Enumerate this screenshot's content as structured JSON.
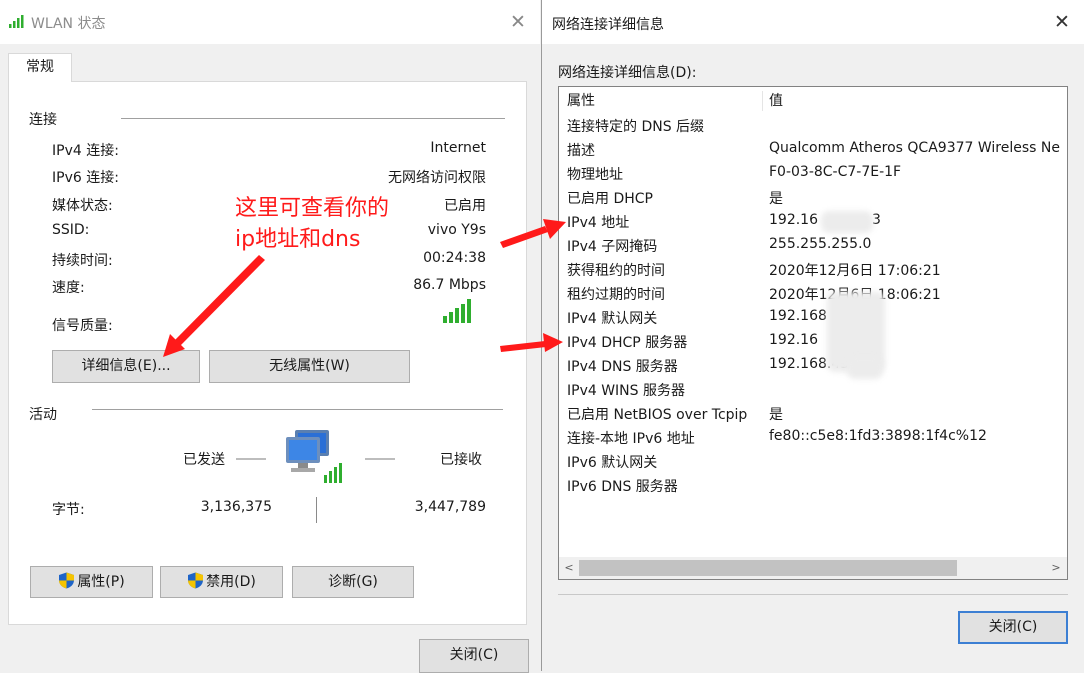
{
  "wlan_window": {
    "title": "WLAN 状态",
    "close_glyph": "✕",
    "tab": "常规",
    "connection": {
      "heading": "连接",
      "rows": [
        {
          "label": "IPv4 连接:",
          "value": "Internet"
        },
        {
          "label": "IPv6 连接:",
          "value": "无网络访问权限"
        },
        {
          "label": "媒体状态:",
          "value": "已启用"
        },
        {
          "label": "SSID:",
          "value": "vivo Y9s"
        },
        {
          "label": "持续时间:",
          "value": "00:24:38"
        },
        {
          "label": "速度:",
          "value": "86.7 Mbps"
        }
      ],
      "signal_label": "信号质量:",
      "signal_bars": 5
    },
    "buttons": {
      "details": "详细信息(E)...",
      "wireless_props": "无线属性(W)"
    },
    "activity": {
      "heading": "活动",
      "sent_label": "已发送",
      "received_label": "已接收",
      "bytes_label": "字节:",
      "bytes_sent": "3,136,375",
      "bytes_received": "3,447,789"
    },
    "bottom_buttons": {
      "properties": "属性(P)",
      "disable": "禁用(D)",
      "diagnose": "诊断(G)"
    },
    "close_button": "关闭(C)"
  },
  "annotation": {
    "line1": "这里可查看你的",
    "line2": "ip地址和dns",
    "color": "#ff1a1a"
  },
  "details_window": {
    "title": "网络连接详细信息",
    "close_glyph": "✕",
    "caption": "网络连接详细信息(D):",
    "columns": {
      "property": "属性",
      "value": "值"
    },
    "rows": [
      {
        "property": "连接特定的 DNS 后缀",
        "value": ""
      },
      {
        "property": "描述",
        "value": "Qualcomm Atheros QCA9377 Wireless Ne"
      },
      {
        "property": "物理地址",
        "value": "F0-03-8C-C7-7E-1F"
      },
      {
        "property": "已启用 DHCP",
        "value": "是"
      },
      {
        "property": "IPv4 地址",
        "value": "192.16",
        "value_tail": "3"
      },
      {
        "property": "IPv4 子网掩码",
        "value": "255.255.255.0"
      },
      {
        "property": "获得租约的时间",
        "value": "2020年12月6日 17:06:21"
      },
      {
        "property": "租约过期的时间",
        "value": "2020年12月6日 18:06:21"
      },
      {
        "property": "IPv4 默认网关",
        "value": "192.168"
      },
      {
        "property": "IPv4 DHCP 服务器",
        "value": "192.16"
      },
      {
        "property": "IPv4 DNS 服务器",
        "value": "192.168.43"
      },
      {
        "property": "IPv4 WINS 服务器",
        "value": ""
      },
      {
        "property": "已启用 NetBIOS over Tcpip",
        "value": "是"
      },
      {
        "property": "连接-本地 IPv6 地址",
        "value": "fe80::c5e8:1fd3:3898:1f4c%12"
      },
      {
        "property": "IPv6 默认网关",
        "value": ""
      },
      {
        "property": "IPv6 DNS 服务器",
        "value": ""
      }
    ],
    "scroll_left": "<",
    "scroll_right": ">",
    "close_button": "关闭(C)"
  },
  "colors": {
    "accent_border": "#3c7fd3",
    "signal_green": "#2fae2f",
    "shield_blue": "#1e64c8",
    "shield_yellow": "#f5c400"
  }
}
